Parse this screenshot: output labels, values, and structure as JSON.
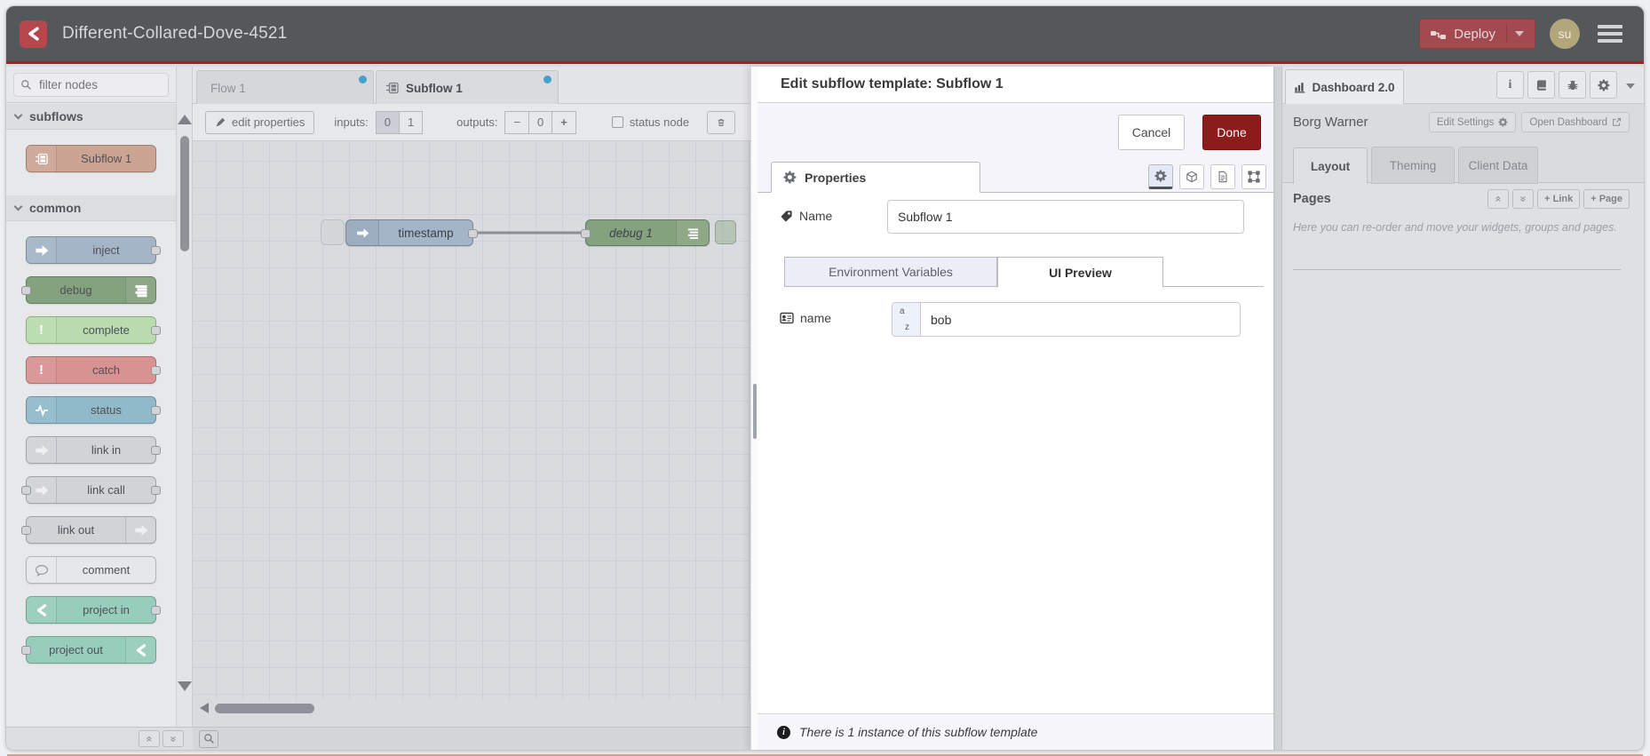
{
  "window": {
    "title": "Different-Collared-Dove-4521",
    "deploy_label": "Deploy",
    "avatar_initials": "su"
  },
  "palette": {
    "filter_placeholder": "filter nodes",
    "categories": [
      {
        "label": "subflows"
      },
      {
        "label": "common"
      }
    ],
    "items": [
      {
        "cat": 0,
        "label": "Subflow 1",
        "color": "#cca493",
        "icon": "subflow",
        "side": "left",
        "pl": false,
        "pr": false
      },
      {
        "cat": 1,
        "label": "inject",
        "color": "#a3b5c7",
        "icon": "arrow",
        "side": "left",
        "pl": false,
        "pr": true
      },
      {
        "cat": 1,
        "label": "debug",
        "color": "#84a27e",
        "icon": "lines",
        "side": "right",
        "pl": true,
        "pr": false
      },
      {
        "cat": 1,
        "label": "complete",
        "color": "#b8dcae",
        "icon": "excl",
        "side": "left",
        "pl": false,
        "pr": true
      },
      {
        "cat": 1,
        "label": "catch",
        "color": "#d89292",
        "icon": "excl",
        "side": "left",
        "pl": false,
        "pr": true
      },
      {
        "cat": 1,
        "label": "status",
        "color": "#90bac9",
        "icon": "wave",
        "side": "left",
        "pl": false,
        "pr": true
      },
      {
        "cat": 1,
        "label": "link in",
        "color": "#d2d3d6",
        "icon": "arrowf",
        "side": "left",
        "pl": false,
        "pr": true
      },
      {
        "cat": 1,
        "label": "link call",
        "color": "#d2d3d6",
        "icon": "arrowf",
        "side": "left",
        "pl": true,
        "pr": true
      },
      {
        "cat": 1,
        "label": "link out",
        "color": "#d2d3d6",
        "icon": "arrowf",
        "side": "right",
        "pl": true,
        "pr": false
      },
      {
        "cat": 1,
        "label": "comment",
        "color": "#e6e7ea",
        "icon": "bubble",
        "side": "left",
        "pl": false,
        "pr": false
      },
      {
        "cat": 1,
        "label": "project in",
        "color": "#97cdbb",
        "icon": "logo",
        "side": "left",
        "pl": false,
        "pr": true
      },
      {
        "cat": 1,
        "label": "project out",
        "color": "#97cdbb",
        "icon": "logo",
        "side": "right",
        "pl": true,
        "pr": false
      }
    ]
  },
  "workspace": {
    "tabs": [
      {
        "label": "Flow 1"
      },
      {
        "label": "Subflow 1"
      }
    ],
    "toolbar": {
      "edit_properties": "edit properties",
      "inputs_label": "inputs:",
      "inputs_options": [
        "0",
        "1"
      ],
      "inputs_selected": "0",
      "outputs_label": "outputs:",
      "minus": "−",
      "outputs_value": "0",
      "plus": "+",
      "status_node_label": "status node"
    },
    "nodes": [
      {
        "label": "timestamp"
      },
      {
        "label": "debug 1"
      }
    ]
  },
  "dialog": {
    "title": "Edit subflow template: Subflow 1",
    "cancel_label": "Cancel",
    "done_label": "Done",
    "properties_tab": "Properties",
    "name_label": "Name",
    "name_value": "Subflow 1",
    "subtabs": [
      {
        "label": "Environment Variables"
      },
      {
        "label": "UI Preview"
      }
    ],
    "env_field": {
      "label": "name",
      "value": "bob"
    },
    "footer_note": "There is 1 instance of this subflow template"
  },
  "sidebar": {
    "tab_label": "Dashboard 2.0",
    "project_label": "Borg Warner",
    "edit_settings_label": "Edit Settings",
    "open_dashboard_label": "Open Dashboard",
    "tabs": [
      {
        "label": "Layout"
      },
      {
        "label": "Theming"
      },
      {
        "label": "Client Data"
      }
    ],
    "pages_label": "Pages",
    "link_button": "+ Link",
    "page_button": "+ Page",
    "help_text": "Here you can re-order and move your widgets, groups and pages."
  },
  "colors": {
    "header_bg": "#55585a",
    "accent_red": "#bb1520",
    "deploy_bg": "#a34a50",
    "done_bg": "#8c1b1b",
    "tab_dot": "#45a3c9"
  }
}
